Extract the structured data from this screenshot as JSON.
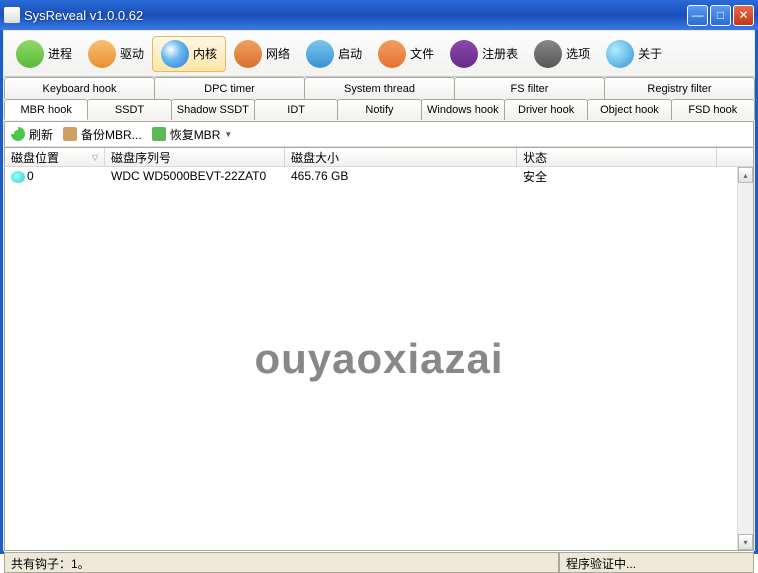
{
  "window": {
    "title": "SysReveal v1.0.0.62"
  },
  "toolbar": [
    {
      "name": "process",
      "label": "进程"
    },
    {
      "name": "driver",
      "label": "驱动"
    },
    {
      "name": "kernel",
      "label": "内核"
    },
    {
      "name": "network",
      "label": "网络"
    },
    {
      "name": "startup",
      "label": "启动"
    },
    {
      "name": "file",
      "label": "文件"
    },
    {
      "name": "registry",
      "label": "注册表"
    },
    {
      "name": "options",
      "label": "选项"
    },
    {
      "name": "about",
      "label": "关于"
    }
  ],
  "tabs_row1": [
    "Keyboard hook",
    "DPC timer",
    "System thread",
    "FS filter",
    "Registry filter"
  ],
  "tabs_row2": [
    "MBR hook",
    "SSDT",
    "Shadow SSDT",
    "IDT",
    "Notify",
    "Windows hook",
    "Driver hook",
    "Object hook",
    "FSD hook"
  ],
  "subtoolbar": {
    "refresh": "刷新",
    "backup": "备份MBR...",
    "restore": "恢复MBR"
  },
  "columns": {
    "disk_location": "磁盘位置",
    "disk_serial": "磁盘序列号",
    "disk_size": "磁盘大小",
    "status": "状态"
  },
  "rows": [
    {
      "location": "0",
      "serial": "WDC WD5000BEVT-22ZAT0",
      "size": "465.76 GB",
      "status": "安全"
    }
  ],
  "watermark": "ouyaoxiazai",
  "statusbar": {
    "left": "共有钩子：1。",
    "right": "程序验证中..."
  }
}
